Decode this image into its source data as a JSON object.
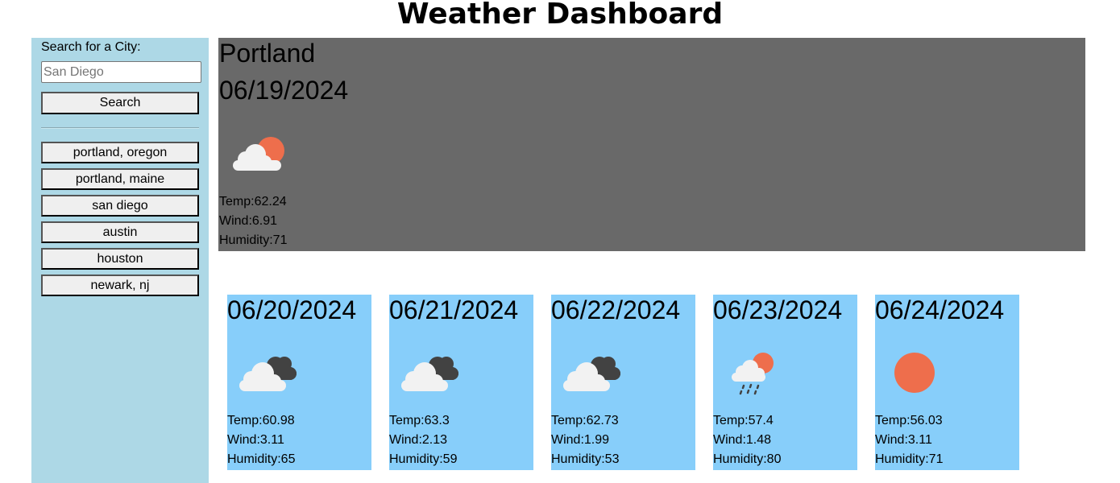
{
  "header": {
    "title": "Weather Dashboard"
  },
  "sidebar": {
    "search_label": "Search for a City:",
    "search_placeholder": "San Diego",
    "search_button": "Search",
    "history": [
      "portland, oregon",
      "portland, maine",
      "san diego",
      "austin",
      "houston",
      "newark, nj"
    ]
  },
  "current": {
    "city": "Portland",
    "date": "06/19/2024",
    "icon": "partly-cloudy-day-icon",
    "temp": "Temp:62.24",
    "wind": "Wind:6.91",
    "humidity": "Humidity:71"
  },
  "forecast": [
    {
      "date": "06/20/2024",
      "icon": "broken-clouds-icon",
      "temp": "Temp:60.98",
      "wind": "Wind:3.11",
      "humidity": "Humidity:65"
    },
    {
      "date": "06/21/2024",
      "icon": "broken-clouds-icon",
      "temp": "Temp:63.3",
      "wind": "Wind:2.13",
      "humidity": "Humidity:59"
    },
    {
      "date": "06/22/2024",
      "icon": "broken-clouds-icon",
      "temp": "Temp:62.73",
      "wind": "Wind:1.99",
      "humidity": "Humidity:53"
    },
    {
      "date": "06/23/2024",
      "icon": "rain-sun-icon",
      "temp": "Temp:57.4",
      "wind": "Wind:1.48",
      "humidity": "Humidity:80"
    },
    {
      "date": "06/24/2024",
      "icon": "clear-sky-icon",
      "temp": "Temp:56.03",
      "wind": "Wind:3.11",
      "humidity": "Humidity:71"
    }
  ],
  "colors": {
    "sidebar_bg": "#add8e6",
    "current_bg": "#696969",
    "card_bg": "#87cefa",
    "sun": "#ee6e4c",
    "cloud_light": "#f2f2f2",
    "cloud_dark": "#424242"
  }
}
